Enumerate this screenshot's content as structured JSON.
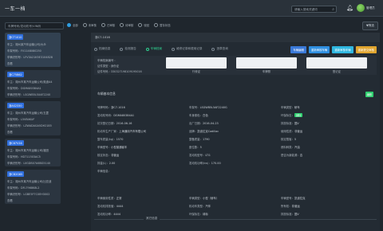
{
  "app": {
    "title": "一车一档"
  },
  "header": {
    "search_placeholder": "请输入搜索关键词",
    "user_name": "管理员"
  },
  "filter": {
    "vin_placeholder": "车牌号码/发动机号/VIN码",
    "radios": [
      {
        "label": "全部",
        "active": true
      },
      {
        "label": "未审核",
        "active": false
      },
      {
        "label": "已审核",
        "active": false
      },
      {
        "label": "待审核",
        "active": false
      },
      {
        "label": "驳回",
        "active": false
      },
      {
        "label": "暂存状态",
        "active": false
      }
    ],
    "filter_button": "▼筛选"
  },
  "list": [
    {
      "tag": "浙CT1010",
      "owner": "车主：湖州某汽车运输公司/大众",
      "plate_no": "车架号码：FV1148080250",
      "vin": "车辆识别号：LFV3A21K5E3104828",
      "status": "查看",
      "selected": true
    },
    {
      "tag": "浙C75B62",
      "owner": "车主：湖州市某汽车运输公司/奥迪A4",
      "plate_no": "车架号码：DGMA80384A1",
      "vin": "车辆识别号：LSGWB5L5XAF2240",
      "status": "",
      "selected": false
    },
    {
      "tag": "浙AS2330",
      "owner": "车主：湖州市某汽车运输公司/五菱",
      "plate_no": "车架号码：L5VB4KUF",
      "vin": "车辆识别号：LZWADAGA5DH2185",
      "status": "查看",
      "selected": false
    },
    {
      "tag": "浙C67V16",
      "owner": "车主：湖州市某汽车运输公司/福田",
      "plate_no": "车架号码：HD711503AC5",
      "vin": "车辆识别号：LVGDB07A6BG5140",
      "status": "",
      "selected": false
    },
    {
      "tag": "浙CB2G65",
      "owner": "车主：湖州市某汽车运输公司/比亚迪",
      "plate_no": "车架号码：DFL7968K8L2",
      "vin": "车辆识别号：LGBE5F7C0EH3002",
      "status": "查看",
      "selected": false
    }
  ],
  "main": {
    "plate_label": "浙C7-1016",
    "tabs": [
      {
        "label": "档案信息",
        "active": false
      },
      {
        "label": "检测报告",
        "active": false
      },
      {
        "label": "车辆档案",
        "active": true
      },
      {
        "label": "维修记录和费用记录",
        "active": false
      },
      {
        "label": "违章查询",
        "active": false
      }
    ],
    "actions": [
      {
        "label": "车辆编辑",
        "color": "#3a79d8"
      },
      {
        "label": "重新审核车辆",
        "color": "#2f8fe0"
      },
      {
        "label": "重新审核车辆",
        "color": "#2fb7e0"
      },
      {
        "label": "重新提交审核",
        "color": "#e0a52f"
      }
    ],
    "overview": {
      "line1": "车辆档案编号 :",
      "line2": "证件类型 : 身份证",
      "line3": "证件号码 : 330327198109195016",
      "cells": [
        "行驶证",
        "车牌照",
        "登记证"
      ]
    },
    "basic_section": "车辆基本信息",
    "badge": "编辑",
    "basic_rows": [
      [
        {
          "k": "号牌号码",
          "v": "浙C7-1016"
        },
        {
          "k": "车架号",
          "v": "LSGWB5L5AF2240G"
        },
        {
          "k": "车辆类型",
          "v": "轿车"
        }
      ],
      [
        {
          "k": "发动机号码",
          "v": "DGMA80384A1"
        },
        {
          "k": "车身颜色",
          "v": "白色"
        },
        {
          "k": "环保标志",
          "v": "绿标"
        }
      ],
      [
        {
          "k": "初次登记日期",
          "v": "2016-06-16"
        },
        {
          "k": "出厂日期",
          "v": "2016-04-23"
        },
        {
          "k": "排放标准",
          "v": "国V"
        }
      ],
      [
        {
          "k": "机动车生产厂家",
          "v": "上海通用汽车有限公司"
        },
        {
          "k": "品牌",
          "v": "凯迪拉克Cadillac"
        },
        {
          "k": "使用性质",
          "v": "非营运"
        }
      ],
      [
        {
          "k": "整车质量(kg)",
          "v": "1570"
        },
        {
          "k": "整备质量",
          "v": "1790"
        },
        {
          "k": "核定载客",
          "v": "5"
        }
      ],
      [
        {
          "k": "车辆型号",
          "v": "小型普通客车"
        },
        {
          "k": "座位数",
          "v": "5"
        },
        {
          "k": "燃料种类",
          "v": "汽油"
        }
      ],
      [
        {
          "k": "核定状态",
          "v": "非营运"
        },
        {
          "k": "发动机型号",
          "v": "LTG"
        },
        {
          "k": "是否为新能源",
          "v": "否"
        }
      ],
      [
        {
          "k": "排量(L)",
          "v": "2.00"
        },
        {
          "k": "发动机功率(kw)",
          "v": "170.00"
        },
        {
          "k": "",
          "v": ""
        }
      ],
      [
        {
          "k": "车辆信息",
          "v": ""
        },
        {
          "k": "",
          "v": ""
        },
        {
          "k": "",
          "v": ""
        }
      ]
    ],
    "other_section": "其它信息",
    "other_rows": [
      [
        {
          "k": "车辆使用性质",
          "v": "正常"
        },
        {
          "k": "车辆类型",
          "v": "小型（轿车）"
        },
        {
          "k": "车辆型号",
          "v": "凯迪拉克"
        }
      ],
      [
        {
          "k": "发动机排放值",
          "v": "4444"
        },
        {
          "k": "机动车类型",
          "v": "汽车"
        },
        {
          "k": "所有权",
          "v": "非营运"
        }
      ],
      [
        {
          "k": "发动机功率",
          "v": "4444"
        },
        {
          "k": "环保标志",
          "v": "绿标"
        },
        {
          "k": "排放标准",
          "v": "国V"
        }
      ]
    ]
  }
}
